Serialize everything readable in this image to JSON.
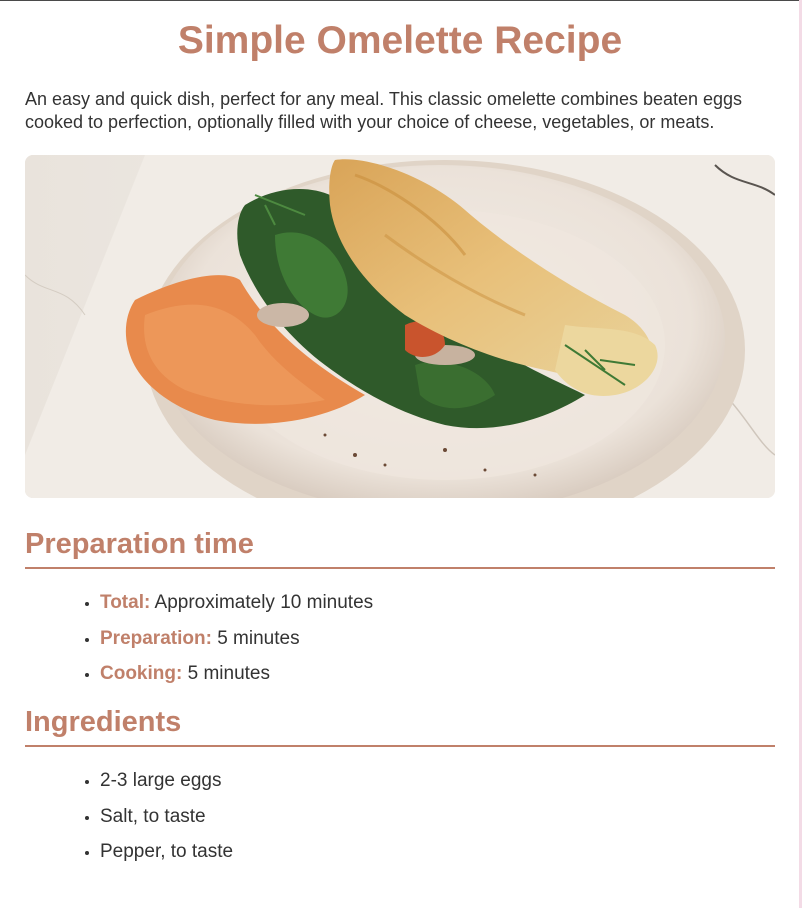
{
  "page": {
    "title": "Simple Omelette Recipe",
    "intro": "An easy and quick dish, perfect for any meal. This classic omelette combines beaten eggs cooked to perfection, optionally filled with your choice of cheese, vegetables, or meats."
  },
  "image": {
    "subject": "omelette-with-spinach-and-carrot-spread-photo"
  },
  "prep_time": {
    "heading": "Preparation time",
    "items": [
      {
        "label": "Total:",
        "value": "Approximately 10 minutes"
      },
      {
        "label": "Preparation:",
        "value": "5 minutes"
      },
      {
        "label": "Cooking:",
        "value": "5 minutes"
      }
    ]
  },
  "ingredients": {
    "heading": "Ingredients",
    "items": [
      "2-3 large eggs",
      "Salt, to taste",
      "Pepper, to taste"
    ]
  },
  "colors": {
    "accent": "#c0806a",
    "text": "#333333"
  }
}
